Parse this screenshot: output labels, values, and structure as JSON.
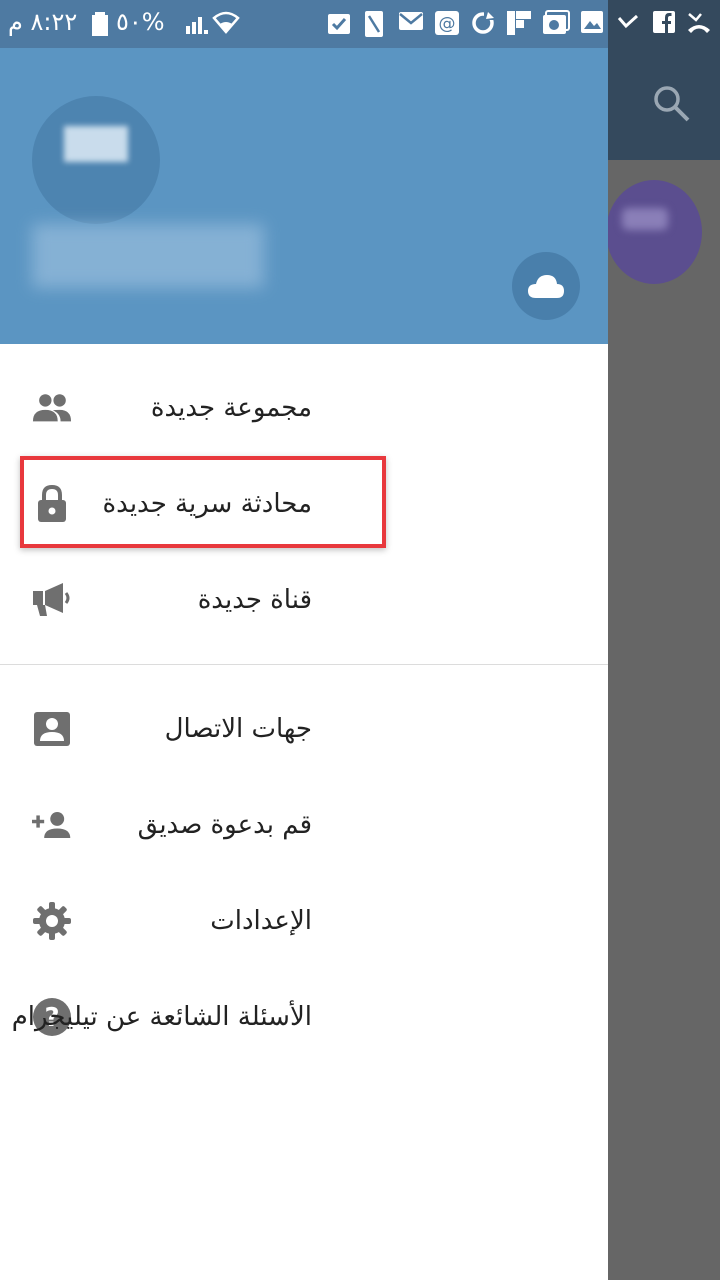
{
  "status_bar": {
    "time": "٨:٢٢ م",
    "battery": "%٥٠"
  },
  "menu": {
    "group1": [
      {
        "label": "مجموعة جديدة",
        "icon": "group-icon"
      },
      {
        "label": "محادثة سرية جديدة",
        "icon": "lock-icon"
      },
      {
        "label": "قناة جديدة",
        "icon": "megaphone-icon"
      }
    ],
    "group2": [
      {
        "label": "جهات الاتصال",
        "icon": "contact-card-icon"
      },
      {
        "label": "قم بدعوة صديق",
        "icon": "add-person-icon"
      },
      {
        "label": "الإعدادات",
        "icon": "gear-icon"
      },
      {
        "label": "الأسئلة الشائعة عن تيليجرام",
        "icon": "help-icon"
      }
    ]
  },
  "colors": {
    "header": "#5b95c2",
    "status_bar": "#4e7aa2",
    "icon": "#6f6f6f",
    "highlight": "#e8383d"
  }
}
